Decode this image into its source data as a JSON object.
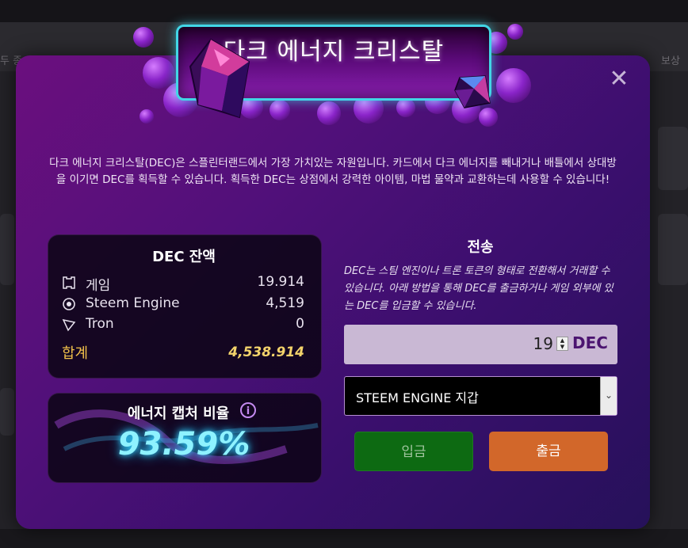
{
  "background": {
    "header_left_text": "두 종",
    "header_right_text": "보상"
  },
  "modal": {
    "title": "다크 에너지 크리스탈",
    "close_label": "✕",
    "intro": "다크 에너지 크리스탈(DEC)은 스플린터랜드에서 가장 가치있는 자원입니다. 카드에서 다크 에너지를 빼내거나 배틀에서 상대방을 이기면 DEC를 획득할 수 있습니다. 획득한 DEC는 상점에서 강력한 아이템, 마법 물약과 교환하는데 사용할 수 있습니다!"
  },
  "balance": {
    "title": "DEC 잔액",
    "rows": [
      {
        "icon": "game-icon",
        "label": "게임",
        "value": "19.914"
      },
      {
        "icon": "steem-engine-icon",
        "label": "Steem Engine",
        "value": "4,519"
      },
      {
        "icon": "tron-icon",
        "label": "Tron",
        "value": "0"
      }
    ],
    "total_label": "합계",
    "total_value": "4,538.914"
  },
  "capture": {
    "title": "에너지 캡처 비율",
    "info_icon": "i",
    "rate": "93.59%"
  },
  "transfer": {
    "title": "전송",
    "description": "DEC는 스팀 엔진이나 트론 토큰의 형태로 전환해서 거래할 수 있습니다. 아래 방법을 통해 DEC를 출금하거나 게임 외부에 있는 DEC를 입금할 수 있습니다.",
    "amount": "19",
    "unit": "DEC",
    "wallet": "STEEM ENGINE 지갑",
    "deposit_label": "입금",
    "withdraw_label": "출금"
  },
  "colors": {
    "accent_cyan": "#42d6e6",
    "deposit_green": "#0d6a12",
    "withdraw_orange": "#d2672a",
    "total_gold": "#f3d36b"
  }
}
